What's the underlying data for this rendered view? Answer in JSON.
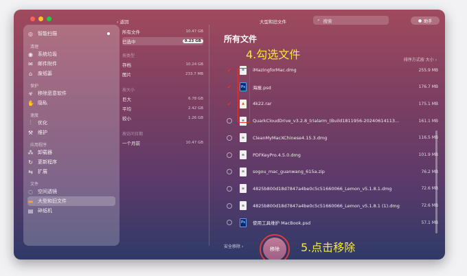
{
  "window": {
    "traffic_colors": [
      "#ff5f57",
      "#febc2e",
      "#28c840"
    ],
    "back_label": "返回",
    "title": "大型和旧文件",
    "search_placeholder": "搜索",
    "helper_label": "助手"
  },
  "sidebar": {
    "top_item": "智能扫描",
    "sections": [
      {
        "title": "清理",
        "items": [
          {
            "label": "系统垃圾",
            "icon": "disk-icon"
          },
          {
            "label": "邮件附件",
            "icon": "mail-icon"
          },
          {
            "label": "废纸篓",
            "icon": "trash-icon"
          }
        ]
      },
      {
        "title": "保护",
        "items": [
          {
            "label": "移除恶意软件",
            "icon": "biohazard-icon"
          },
          {
            "label": "隐私",
            "icon": "hand-icon"
          }
        ]
      },
      {
        "title": "速度",
        "items": [
          {
            "label": "优化",
            "icon": "sliders-icon"
          },
          {
            "label": "维护",
            "icon": "wrench-icon"
          }
        ]
      },
      {
        "title": "应用程序",
        "items": [
          {
            "label": "卸载器",
            "icon": "apps-icon"
          },
          {
            "label": "更新程序",
            "icon": "update-icon"
          },
          {
            "label": "扩展",
            "icon": "extension-icon"
          }
        ]
      },
      {
        "title": "文件",
        "items": [
          {
            "label": "空间透镜",
            "icon": "lens-icon"
          },
          {
            "label": "大型和旧文件",
            "icon": "folder-icon"
          },
          {
            "label": "碎纸机",
            "icon": "shredder-icon"
          }
        ]
      }
    ]
  },
  "filters": {
    "all": {
      "label": "所有文件",
      "size": "10.47 GB"
    },
    "selected": {
      "label": "已选中",
      "size": "9.23 GB"
    },
    "by_kind_title": "按类型",
    "kinds": [
      {
        "label": "存档",
        "size": "10.24 GB"
      },
      {
        "label": "图片",
        "size": "233.7 MB"
      }
    ],
    "by_size_title": "按大小",
    "sizes": [
      {
        "label": "巨大",
        "size": "6.78 GB"
      },
      {
        "label": "平均",
        "size": "2.42 GB"
      },
      {
        "label": "较小",
        "size": "1.26 GB"
      }
    ],
    "by_date_title": "按访问日期",
    "dates": [
      {
        "label": "一个月前",
        "size": "10.47 GB"
      }
    ]
  },
  "main": {
    "title": "所有文件",
    "sort_label": "排序方式按 大小",
    "annotation_select": "4.勾选文件",
    "annotation_remove": "5.点击移除",
    "files": [
      {
        "name": "iMazingforMac.dmg",
        "size": "255.9 MB",
        "checked": true,
        "kind": "doc"
      },
      {
        "name": "海报.psd",
        "size": "176.7 MB",
        "checked": true,
        "kind": "ps"
      },
      {
        "name": "4k22.rar",
        "size": "175.1 MB",
        "checked": true,
        "kind": "rar"
      },
      {
        "name": "QuarkCloudDrive_v3.2.8_trialarm_(Build1811956-20240614113...",
        "size": "161.1 MB",
        "checked": false,
        "kind": "doc"
      },
      {
        "name": "CleanMyMacXChinese4.15.3.dmg",
        "size": "116.5 MB",
        "checked": false,
        "kind": "doc"
      },
      {
        "name": "PDFKeyPro.4.5.0.dmg",
        "size": "101.9 MB",
        "checked": false,
        "kind": "doc"
      },
      {
        "name": "sogou_mac_guanwang_615a.zip",
        "size": "76.2 MB",
        "checked": false,
        "kind": "doc"
      },
      {
        "name": "4825b800d18d7847a4be0c5c51660066_Lemon_v5.1.8.1.dmg",
        "size": "72.6 MB",
        "checked": false,
        "kind": "doc"
      },
      {
        "name": "4825b800d18d7847a4be0c5c51660066_Lemon_v5.1.8.1 (1).dmg",
        "size": "72.6 MB",
        "checked": false,
        "kind": "doc"
      },
      {
        "name": "使用工具维护 MacBook.psd",
        "size": "57.1 MB",
        "checked": false,
        "kind": "ps"
      }
    ]
  },
  "bottom": {
    "safe_remove_label": "安全移除",
    "remove_label": "移除"
  }
}
